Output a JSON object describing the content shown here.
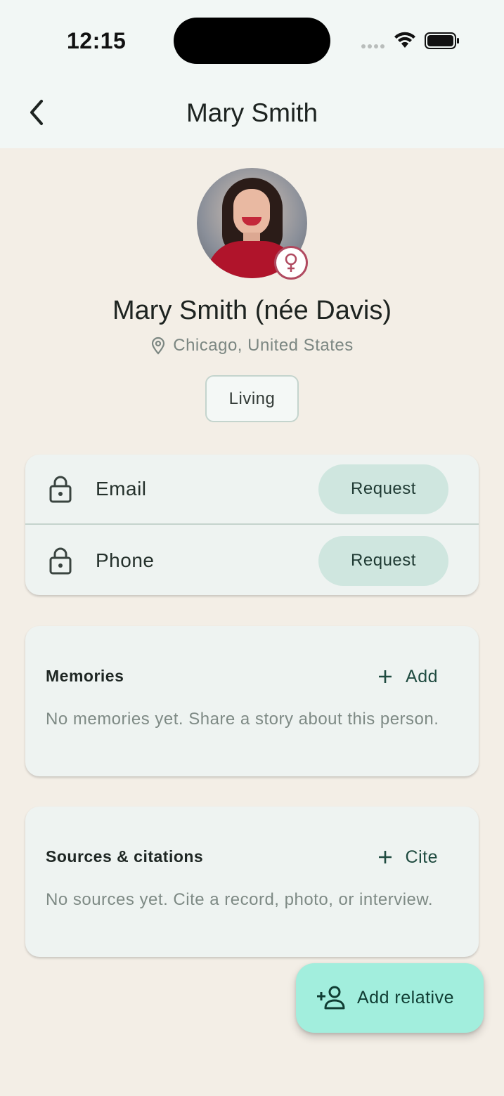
{
  "status_bar": {
    "time": "12:15"
  },
  "app_bar": {
    "title": "Mary Smith",
    "back_icon": "chevron-left-icon"
  },
  "profile": {
    "display_name": "Mary Smith (née Davis)",
    "location": "Chicago, United States",
    "location_icon": "map-pin-icon",
    "gender_icon": "female-symbol-icon",
    "status_chip": "Living"
  },
  "contact": {
    "rows": [
      {
        "icon": "lock-icon",
        "label": "Email",
        "action": "Request"
      },
      {
        "icon": "lock-icon",
        "label": "Phone",
        "action": "Request"
      }
    ]
  },
  "memories": {
    "title": "Memories",
    "action_label": "Add",
    "action_icon": "plus-icon",
    "empty_text": "No memories yet. Share a story about this person."
  },
  "sources": {
    "title": "Sources & citations",
    "action_label": "Cite",
    "action_icon": "plus-icon",
    "empty_text": "No sources yet. Cite a record, photo, or interview."
  },
  "fab": {
    "label": "Add relative",
    "icon": "person-add-icon"
  },
  "colors": {
    "page_background": "#f3eee6",
    "app_bar_background": "#f2f7f5",
    "card_background": "#eef3f1",
    "request_button": "#cfe6df",
    "fab_background": "#a2eedd",
    "gender_accent": "#b04a60"
  }
}
